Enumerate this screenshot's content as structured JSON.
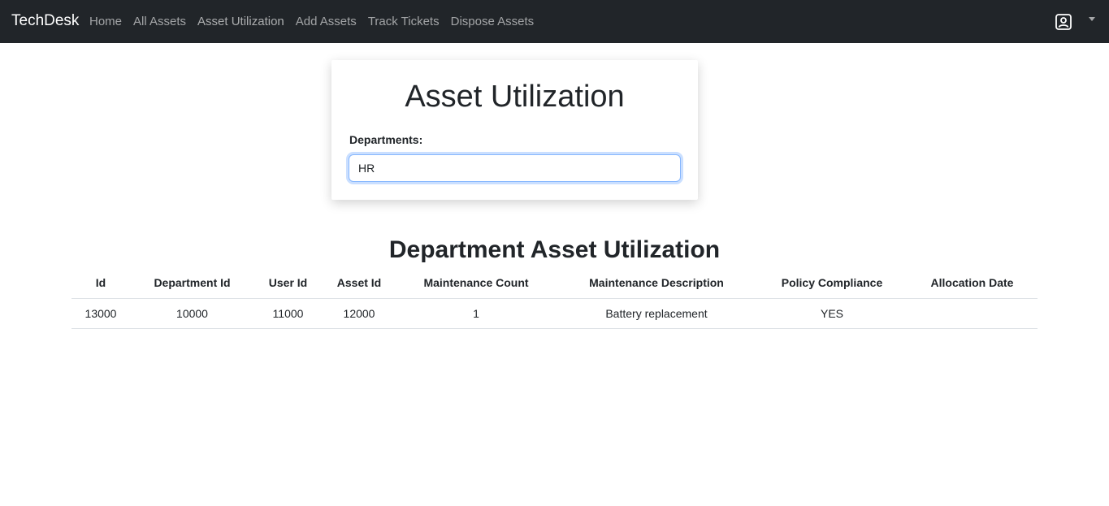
{
  "navbar": {
    "brand": "TechDesk",
    "links": [
      {
        "label": "Home"
      },
      {
        "label": "All Assets"
      },
      {
        "label": "Asset Utilization"
      },
      {
        "label": "Add Assets"
      },
      {
        "label": "Track Tickets"
      },
      {
        "label": "Dispose Assets"
      }
    ],
    "user_icon": "user-square-icon",
    "caret_icon": "caret-down-icon",
    "background": "#212529"
  },
  "card": {
    "title": "Asset Utilization",
    "departments_label": "Departments:",
    "departments_value": "HR"
  },
  "table_section": {
    "title": "Department Asset Utilization",
    "columns": [
      "Id",
      "Department Id",
      "User Id",
      "Asset Id",
      "Maintenance Count",
      "Maintenance Description",
      "Policy Compliance",
      "Allocation Date"
    ],
    "rows": [
      [
        "13000",
        "10000",
        "11000",
        "12000",
        "1",
        "Battery replacement",
        "YES",
        ""
      ]
    ]
  }
}
